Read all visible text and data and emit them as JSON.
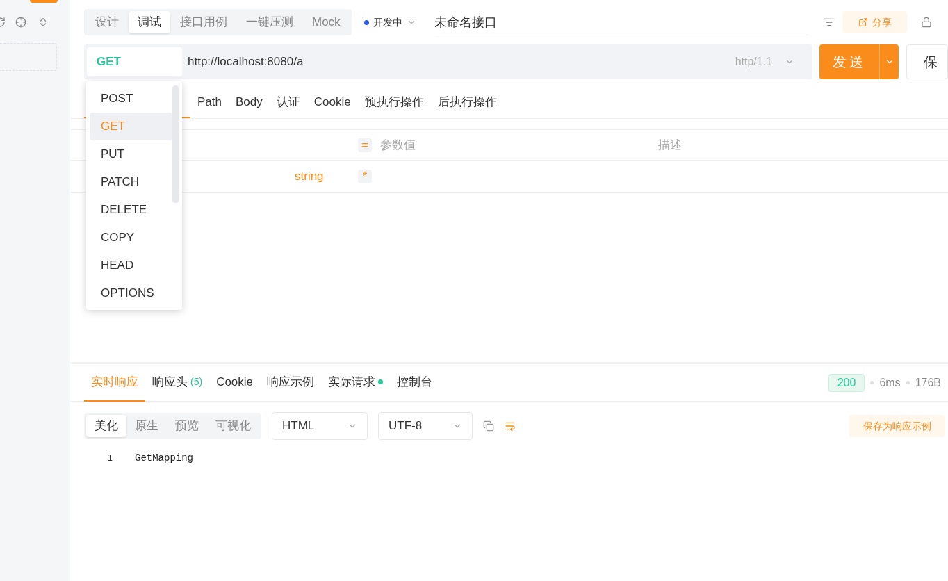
{
  "top_tabs": [
    {
      "label": "设计",
      "selected": false
    },
    {
      "label": "调试",
      "selected": true
    },
    {
      "label": "接口用例",
      "selected": false
    },
    {
      "label": "一键压测",
      "selected": false
    },
    {
      "label": "Mock",
      "selected": false
    }
  ],
  "status": {
    "label": "开发中",
    "color": "#2f5cf5"
  },
  "title": {
    "value": "未命名接口"
  },
  "share_button": "分享",
  "request": {
    "method": "GET",
    "url": "http://localhost:8080/a",
    "protocol": "http/1.1",
    "send": "发送",
    "save": "保"
  },
  "method_menu": [
    {
      "label": "POST",
      "selected": false
    },
    {
      "label": "GET",
      "selected": true
    },
    {
      "label": "PUT",
      "selected": false
    },
    {
      "label": "PATCH",
      "selected": false
    },
    {
      "label": "DELETE",
      "selected": false
    },
    {
      "label": "COPY",
      "selected": false
    },
    {
      "label": "HEAD",
      "selected": false
    },
    {
      "label": "OPTIONS",
      "selected": false
    }
  ],
  "request_tabs": [
    {
      "selected": true
    },
    {
      "label": "Path",
      "selected": false
    },
    {
      "label": "Body",
      "selected": false
    },
    {
      "label": "认证",
      "selected": false
    },
    {
      "label": "Cookie",
      "selected": false
    },
    {
      "label": "预执行操作",
      "selected": false
    },
    {
      "label": "后执行操作",
      "selected": false
    }
  ],
  "params_table": {
    "eq": "=",
    "value_header": "参数值",
    "desc_header": "描述",
    "rows": [
      {
        "type": "string",
        "required": "*"
      }
    ]
  },
  "response_tabs": [
    {
      "label": "实时响应",
      "selected": true
    },
    {
      "label": "响应头",
      "count": "(5)",
      "selected": false
    },
    {
      "label": "Cookie",
      "selected": false
    },
    {
      "label": "响应示例",
      "selected": false
    },
    {
      "label": "实际请求",
      "dot": true,
      "selected": false
    },
    {
      "label": "控制台",
      "selected": false
    }
  ],
  "response_meta": {
    "status_code": "200",
    "time": "6ms",
    "size": "176B"
  },
  "view_modes": [
    {
      "label": "美化",
      "selected": true
    },
    {
      "label": "原生",
      "selected": false
    },
    {
      "label": "预览",
      "selected": false
    },
    {
      "label": "可视化",
      "selected": false
    }
  ],
  "format_select": "HTML",
  "encoding_select": "UTF-8",
  "save_example_button": "保存为响应示例",
  "code_lines": [
    {
      "number": "1",
      "text": "GetMapping"
    }
  ]
}
